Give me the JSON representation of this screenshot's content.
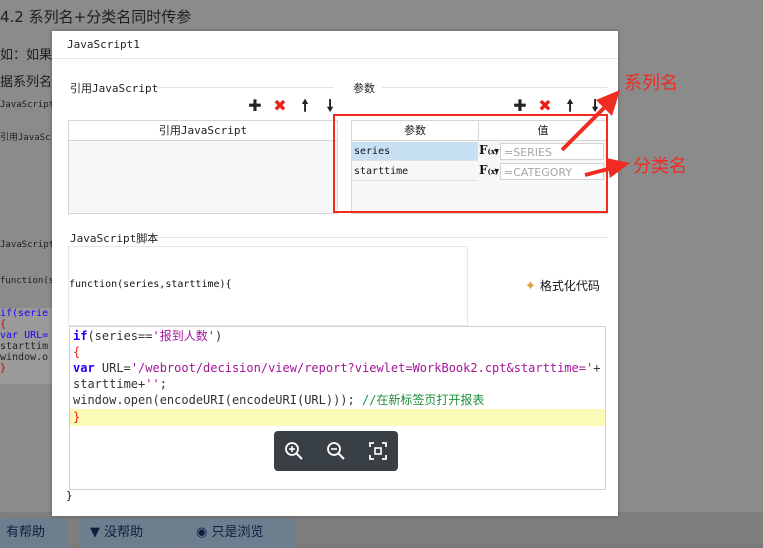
{
  "background": {
    "title": "4.2 系列名+分类名同时传参",
    "line1": "如：如果",
    "line2": "据系列名",
    "small1": "JavaScript",
    "small2": "引用JavaSc",
    "small3": "JavaScript",
    "small4": "function(s",
    "code_lines": [
      "if(serie",
      "{",
      "var URL=",
      "starttim",
      "window.o",
      "}"
    ]
  },
  "feedback": {
    "helpful": "有帮助",
    "not_helpful": "没帮助",
    "just_browsing": "只是浏览"
  },
  "dialog": {
    "title": "JavaScript1",
    "ref_section": "引用JavaScript",
    "ref_column": "引用JavaScript",
    "param_section": "参数",
    "param_col_name": "参数",
    "param_col_value": "值",
    "params": [
      {
        "name": "series",
        "value": "=SERIES"
      },
      {
        "name": "starttime",
        "value": "=CATEGORY"
      }
    ],
    "fx_label": "F",
    "fx_sub": "(x)",
    "script_section": "JavaScript脚本",
    "signature": "function(series,starttime){",
    "format_label": "格式化代码",
    "closing_brace": "}",
    "code": {
      "l1_kw": "if",
      "l1_rest": "(series==",
      "l1_str": "'报到人数'",
      "l1_end": ")",
      "l2": "{",
      "l3_kw": "var",
      "l3_rest": " URL=",
      "l3_str": "'/webroot/decision/view/report?viewlet=WorkBook2.cpt&starttime='",
      "l3_end": "+",
      "l4_rest": "starttime+",
      "l4_str": "''",
      "l4_end": ";",
      "l5_rest": "window.open(encodeURI(encodeURI(URL))); ",
      "l5_cmt": "//在新标签页打开报表",
      "l6": "}"
    }
  },
  "annotations": {
    "series_name": "系列名",
    "category_name": "分类名"
  },
  "colors": {
    "annotation_red": "#ef2b22",
    "keyword_blue": "#1f00ff",
    "string_purple": "#a3159a",
    "comment_green": "#1e8f3c",
    "selected_row": "#c7e1f3"
  }
}
